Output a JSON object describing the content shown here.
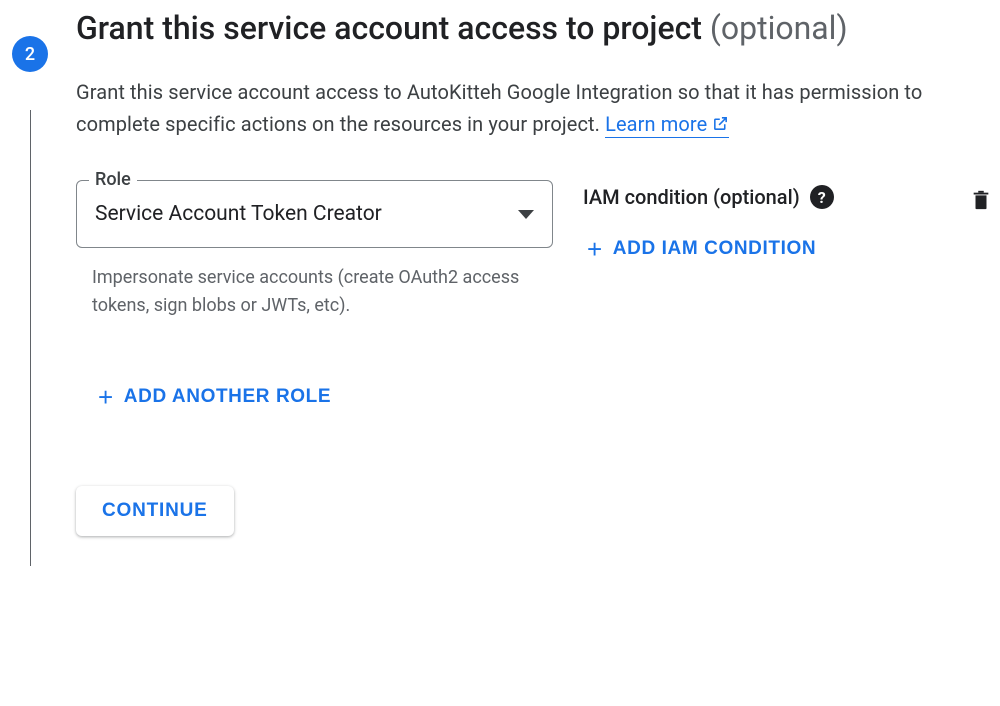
{
  "step": {
    "number": "2",
    "title": "Grant this service account access to project",
    "optional_label": "(optional)"
  },
  "description": {
    "text": "Grant this service account access to AutoKitteh Google Integration so that it has permission to complete specific actions on the resources in your project. ",
    "learn_more": "Learn more"
  },
  "role": {
    "label": "Role",
    "selected": "Service Account Token Creator",
    "helper_text": "Impersonate service accounts (create OAuth2 access tokens, sign blobs or JWTs, etc)."
  },
  "condition": {
    "label": "IAM condition (optional)",
    "add_button": "ADD IAM CONDITION"
  },
  "actions": {
    "add_role": "ADD ANOTHER ROLE",
    "continue": "CONTINUE"
  }
}
